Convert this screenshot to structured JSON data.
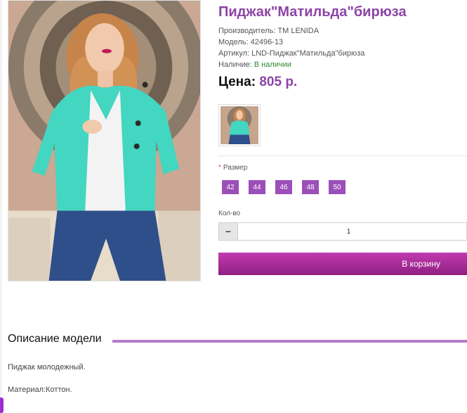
{
  "product": {
    "title": "Пиджак\"Матильда\"бирюза",
    "manufacturer": "Производитель: TM LENIDA",
    "model": "Модель: 42496-13",
    "sku": "Артикул: LND-Пиджак\"Матильда\"бирюза",
    "availability_label": "Наличие:",
    "availability_value": "В наличии",
    "price_label": "Цена:",
    "price_value": "805 р."
  },
  "options": {
    "size_label": "Размер",
    "required_mark": "*",
    "sizes": [
      "42",
      "44",
      "46",
      "48",
      "50"
    ]
  },
  "quantity": {
    "label": "Кол-во",
    "minus": "−",
    "value": "1"
  },
  "cart": {
    "button_label": "В корзину"
  },
  "description": {
    "title": "Описание модели",
    "line1": "Пиджак молодежный.",
    "line2": "Материал:Коттон."
  },
  "colors": {
    "accent": "#8c44a6",
    "size_button": "#9b4fb8",
    "cart_button": "#b22aa2",
    "in_stock": "#2e8b2e",
    "divider": "#b77cc8"
  }
}
